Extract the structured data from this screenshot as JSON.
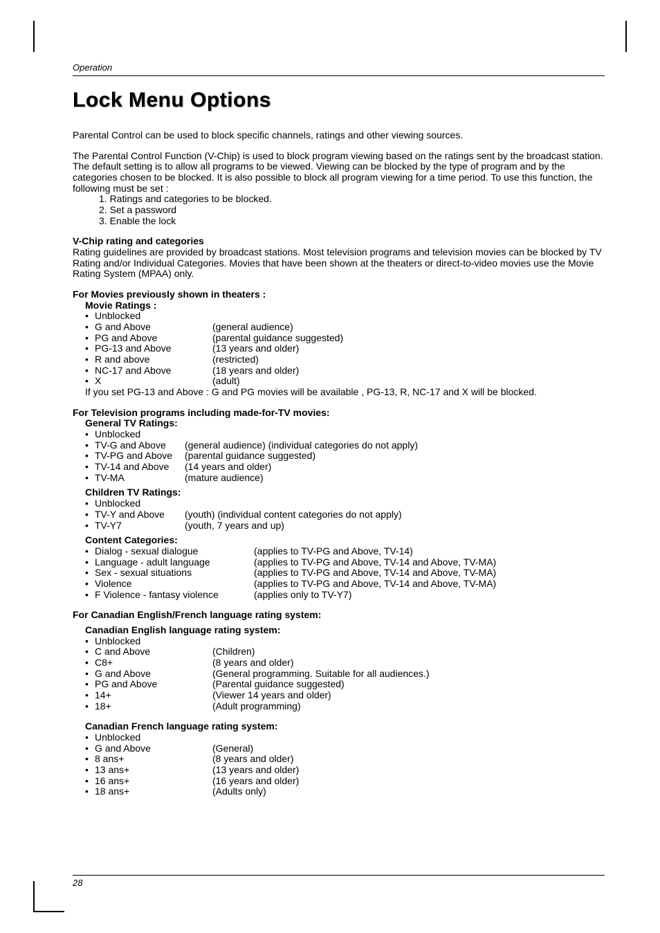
{
  "running_head": "Operation",
  "title": "Lock Menu Options",
  "intro": "Parental Control can be used to block specific channels, ratings and other viewing sources.",
  "vchip_intro": "The Parental Control Function (V-Chip) is used to block program viewing based on the ratings sent by the broadcast station. The default setting is to allow all programs to be viewed. Viewing can be blocked by the type of program and by the categories chosen to be blocked. It is also possible to block all program viewing for a time period. To use this function, the following must be set :",
  "steps": [
    "1. Ratings and categories to be blocked.",
    "2. Set a password",
    "3. Enable the lock"
  ],
  "vchip_heading": "V-Chip rating and categories",
  "vchip_body": "Rating guidelines are provided by broadcast stations. Most television programs and television movies can be blocked by TV Rating and/or Individual Categories. Movies that have been shown at the theaters or direct-to-video movies use the Movie Rating System (MPAA) only.",
  "movies_heading": "For Movies previously shown in theaters :",
  "movie_ratings_heading": "Movie Ratings :",
  "movie_ratings": [
    {
      "label": "Unblocked",
      "desc": ""
    },
    {
      "label": "G and Above",
      "desc": "(general audience)"
    },
    {
      "label": "PG and Above",
      "desc": "(parental guidance suggested)"
    },
    {
      "label": "PG-13 and Above",
      "desc": "(13 years and older)"
    },
    {
      "label": "R and above",
      "desc": "(restricted)"
    },
    {
      "label": "NC-17 and Above",
      "desc": "(18 years and older)"
    },
    {
      "label": "X",
      "desc": "(adult)"
    }
  ],
  "movie_note": "If you set PG-13 and Above : G and PG movies will be available , PG-13, R, NC-17 and X will be blocked.",
  "tv_heading": "For Television programs including made-for-TV movies:",
  "gen_tv_heading": "General TV Ratings:",
  "gen_tv": [
    {
      "label": "Unblocked",
      "desc": ""
    },
    {
      "label": "TV-G and Above",
      "desc": "(general audience) (individual categories do not apply)"
    },
    {
      "label": "TV-PG and Above",
      "desc": "(parental guidance suggested)"
    },
    {
      "label": "TV-14 and Above",
      "desc": "(14 years and older)"
    },
    {
      "label": "TV-MA",
      "desc": "(mature audience)"
    }
  ],
  "child_tv_heading": "Children TV Ratings:",
  "child_tv": [
    {
      "label": "Unblocked",
      "desc": ""
    },
    {
      "label": "TV-Y and Above",
      "desc": "(youth) (individual content categories do not apply)"
    },
    {
      "label": "TV-Y7",
      "desc": "(youth, 7 years and up)"
    }
  ],
  "content_heading": "Content Categories:",
  "content": [
    {
      "label": "Dialog - sexual dialogue",
      "desc": "(applies to TV-PG and Above, TV-14)"
    },
    {
      "label": "Language - adult language",
      "desc": "(applies to TV-PG and Above, TV-14 and Above, TV-MA)"
    },
    {
      "label": "Sex - sexual situations",
      "desc": "(applies to TV-PG and Above, TV-14 and Above, TV-MA)"
    },
    {
      "label": "Violence",
      "desc": "(applies to TV-PG and Above, TV-14 and Above, TV-MA)"
    },
    {
      "label": "F Violence - fantasy violence",
      "desc": "(applies only to TV-Y7)"
    }
  ],
  "can_heading": "For Canadian English/French language rating system:",
  "can_en_heading": "Canadian English language rating system:",
  "can_en": [
    {
      "label": "Unblocked",
      "desc": ""
    },
    {
      "label": "C and Above",
      "desc": "(Children)"
    },
    {
      "label": "C8+",
      "desc": "(8 years and older)"
    },
    {
      "label": "G and Above",
      "desc": "(General programming. Suitable for all audiences.)"
    },
    {
      "label": "PG and Above",
      "desc": "(Parental guidance suggested)"
    },
    {
      "label": "14+",
      "desc": "(Viewer 14 years and older)"
    },
    {
      "label": "18+",
      "desc": "(Adult programming)"
    }
  ],
  "can_fr_heading": "Canadian French language rating system:",
  "can_fr": [
    {
      "label": "Unblocked",
      "desc": ""
    },
    {
      "label": "G and Above",
      "desc": "(General)"
    },
    {
      "label": "8 ans+",
      "desc": "(8 years and older)"
    },
    {
      "label": "13 ans+",
      "desc": "(13 years and older)"
    },
    {
      "label": "16 ans+",
      "desc": "(16 years and older)"
    },
    {
      "label": "18 ans+",
      "desc": "(Adults only)"
    }
  ],
  "page_number": "28"
}
